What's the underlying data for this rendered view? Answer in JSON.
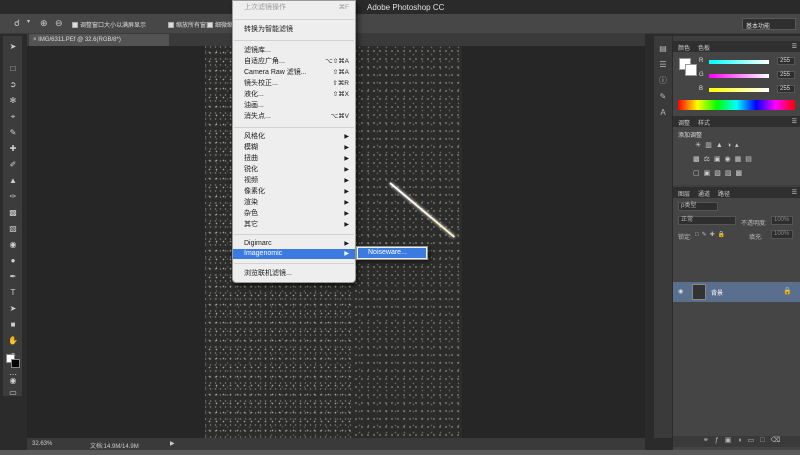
{
  "app": {
    "title": "Adobe Photoshop CC"
  },
  "options_bar": {
    "resize_windows": "调整窗口大小以满屏显示",
    "zoom_all": "缩放所有窗口",
    "scrubby_zoom": "细微缩",
    "workspace": "基本功能"
  },
  "document": {
    "tab_label": "IMG/6311.PEf @ 32.6(RGB/8*)",
    "zoom": "32.63%",
    "doc_size": "文档:14.9M/14.9M"
  },
  "filter_menu": {
    "last_filter": "上次滤镜操作",
    "last_filter_shortcut": "⌘F",
    "convert_smart": "转换为智能滤镜",
    "gallery": "滤镜库...",
    "adaptive_wide": "自适应广角...",
    "adaptive_wide_shortcut": "⌥⇧⌘A",
    "camera_raw": "Camera Raw 滤镜...",
    "camera_raw_shortcut": "⇧⌘A",
    "lens_correction": "镜头校正...",
    "lens_correction_shortcut": "⇧⌘R",
    "liquify": "液化...",
    "liquify_shortcut": "⇧⌘X",
    "oil_paint": "油画...",
    "vanishing_point": "消失点...",
    "vanishing_point_shortcut": "⌥⌘V",
    "stylize": "风格化",
    "blur": "模糊",
    "distort": "扭曲",
    "sharpen": "锐化",
    "video": "视频",
    "pixelate": "像素化",
    "render": "渲染",
    "noise": "杂色",
    "other": "其它",
    "digimarc": "Digimarc",
    "imagenomic": "Imagenomic",
    "browse_online": "浏览联机滤镜..."
  },
  "submenu": {
    "noiseware": "Noiseware..."
  },
  "panels": {
    "color_tab": "颜色",
    "swatches_tab": "色板",
    "r_label": "R",
    "g_label": "G",
    "b_label": "B",
    "r_value": "255",
    "g_value": "255",
    "b_value": "255",
    "adjustments_tab": "调整",
    "styles_tab": "样式",
    "add_adjustment": "添加调整",
    "layers_tab": "图层",
    "channels_tab": "通道",
    "paths_tab": "路径",
    "kind_filter": "p类型",
    "blend_mode": "正常",
    "opacity_label": "不透明度:",
    "opacity_value": "100%",
    "lock_label": "锁定:",
    "fill_label": "填充:",
    "fill_value": "100%",
    "layer_name": "背景"
  },
  "colors": {
    "menu_highlight": "#3b7be0",
    "layer_selected": "#5a6f8e"
  }
}
